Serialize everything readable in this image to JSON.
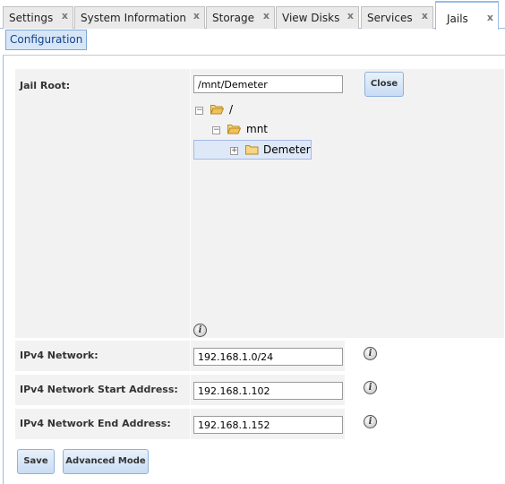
{
  "tabs": [
    {
      "label": "Settings",
      "close": "x"
    },
    {
      "label": "System Information",
      "close": "x"
    },
    {
      "label": "Storage",
      "close": "x"
    },
    {
      "label": "View Disks",
      "close": "x"
    },
    {
      "label": "Services",
      "close": "x"
    },
    {
      "label": "Jails",
      "close": "x"
    }
  ],
  "subtab": {
    "label": "Configuration"
  },
  "form": {
    "jail_root": {
      "label": "Jail Root:",
      "value": "/mnt/Demeter",
      "close_label": "Close"
    },
    "tree": {
      "root": "/",
      "child": "mnt",
      "grandchild": "Demeter"
    },
    "ipv4_network": {
      "label": "IPv4 Network:",
      "value": "192.168.1.0/24"
    },
    "ipv4_start": {
      "label": "IPv4 Network Start Address:",
      "value": "192.168.1.102"
    },
    "ipv4_end": {
      "label": "IPv4 Network End Address:",
      "value": "192.168.1.152"
    },
    "info_glyph": "i"
  },
  "buttons": {
    "save": "Save",
    "advanced": "Advanced Mode"
  },
  "colors": {
    "accent_border": "#99bbe8",
    "field_bg": "#f2f2f2",
    "folder": "#f2c15a"
  }
}
